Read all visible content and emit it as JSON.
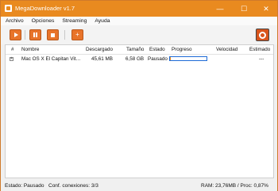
{
  "window": {
    "title": "MegaDownloader v1.7",
    "icons": {
      "app": "app-icon",
      "minimize": "minimize-icon",
      "maximize": "maximize-icon",
      "close": "close-icon"
    },
    "controls": {
      "minimize": "—",
      "maximize": "☐",
      "close": "✕"
    }
  },
  "menu": {
    "items": [
      "Archivo",
      "Opciones",
      "Streaming",
      "Ayuda"
    ]
  },
  "toolbar": {
    "accent": "#e8742a",
    "add_label": "+",
    "icons": [
      "play-icon",
      "pause-icon",
      "stop-icon",
      "add-icon",
      "settings-icon"
    ]
  },
  "table": {
    "columns": [
      "#",
      "Nombre",
      "Descargado",
      "Tamaño",
      "Estado",
      "Progreso",
      "Velocidad",
      "Estimado"
    ],
    "rows": [
      {
        "expander": "+",
        "name": "Mac OS X El Capitan Vit…",
        "downloaded": "45,61 MB",
        "size": "6,58 GB",
        "status": "Pausado",
        "progress": 0.0068,
        "speed": "",
        "eta": "---"
      }
    ]
  },
  "statusbar": {
    "state": "Estado: Pausado",
    "connections": "Conf. conexiones: 3/3",
    "resources": "RAM: 23,76MB / Proc: 0,87%"
  }
}
